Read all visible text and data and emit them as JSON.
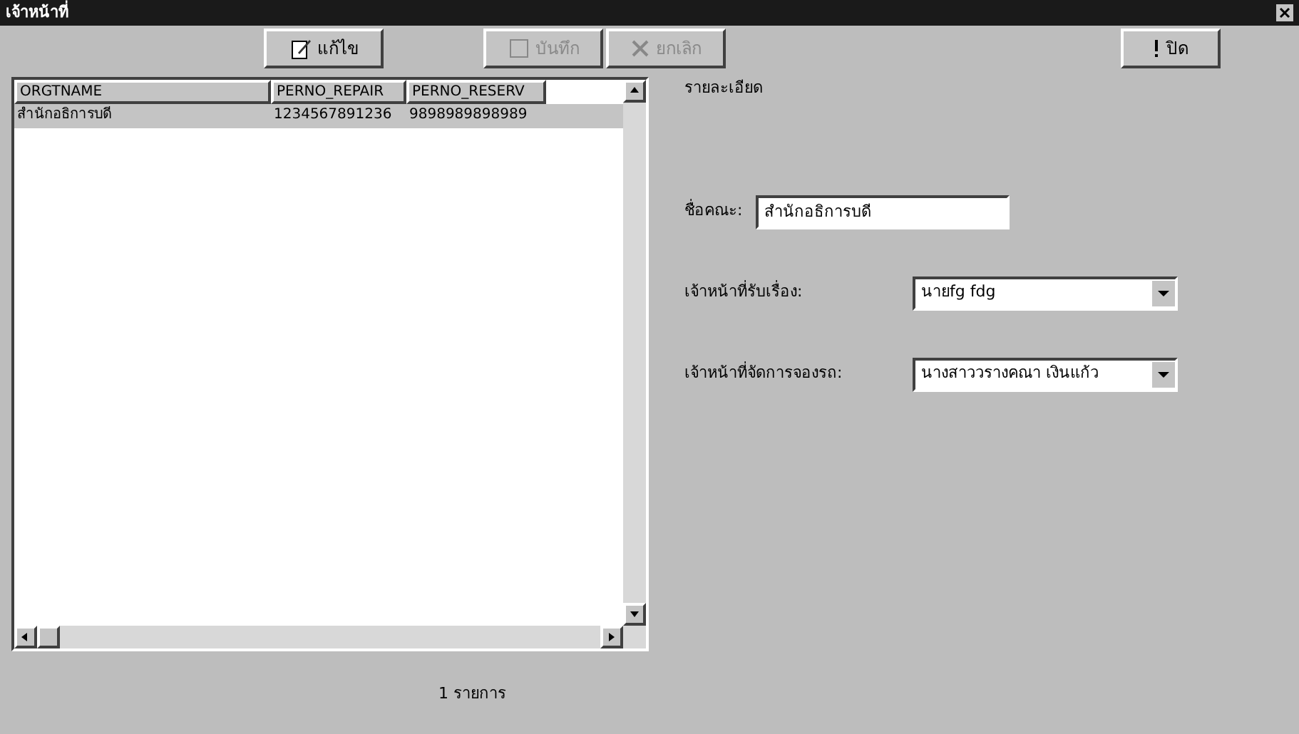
{
  "window": {
    "title": "เจ้าหน้าที่"
  },
  "toolbar": [
    {
      "label": "แก้ไข",
      "kind": "edit",
      "disabled": false
    },
    {
      "label": "บันทึก",
      "kind": "save",
      "disabled": true
    },
    {
      "label": "ยกเลิก",
      "kind": "cancel",
      "disabled": true
    },
    {
      "label": "ปิด",
      "kind": "close",
      "disabled": false
    }
  ],
  "table": {
    "columns": [
      "ORGTNAME",
      "PERNO_REPAIR",
      "PERNO_RESERV"
    ],
    "rows": [
      [
        "สำนักอธิการบดี",
        "1234567891236",
        "9898989898989"
      ]
    ]
  },
  "status": "1 รายการ",
  "details": {
    "title": "รายละเอียด",
    "fields": [
      {
        "label": "ชื่อคณะ:",
        "value": "สำนักอธิการบดี",
        "kind": "text"
      },
      {
        "label": "เจ้าหน้าที่รับเรื่อง:",
        "value": "นายfg fdg",
        "kind": "combo"
      },
      {
        "label": "เจ้าหน้าที่จัดการจองรถ:",
        "value": "นางสาววรางคณา เงินแก้ว",
        "kind": "combo"
      }
    ]
  }
}
